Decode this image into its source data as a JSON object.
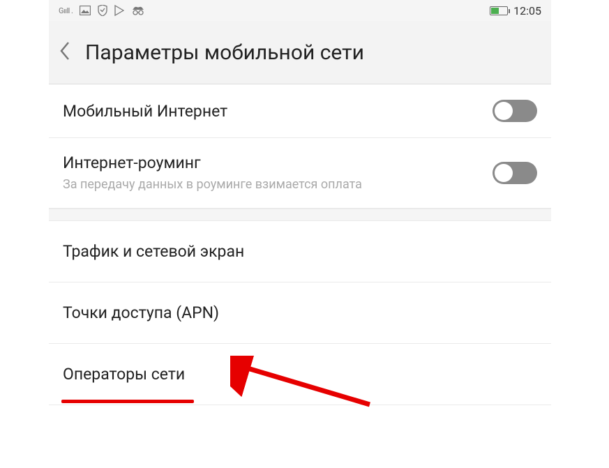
{
  "statusbar": {
    "signal_label": "Gııll .",
    "time": "12:05"
  },
  "header": {
    "title": "Параметры мобильной сети"
  },
  "rows": {
    "mobile_internet": {
      "title": "Мобильный Интернет"
    },
    "internet_roaming": {
      "title": "Интернет-роуминг",
      "desc": "За передачу данных в роуминге взимается оплата"
    },
    "traffic_firewall": {
      "title": "Трафик и сетевой экран"
    },
    "apn": {
      "title": "Точки доступа (APN)"
    },
    "operators": {
      "title": "Операторы сети"
    }
  }
}
